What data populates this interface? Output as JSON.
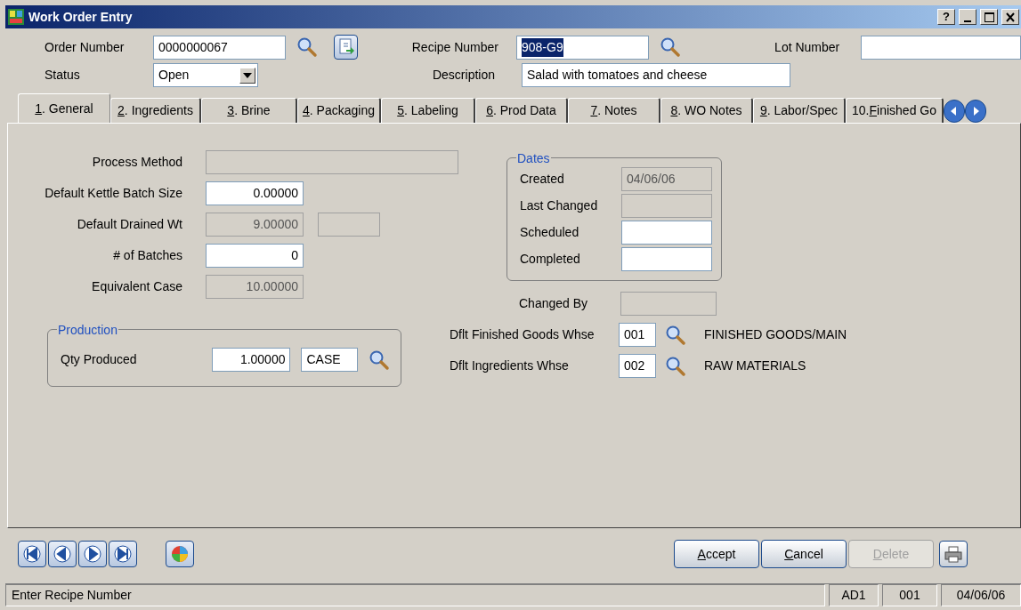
{
  "window": {
    "title": "Work Order Entry",
    "help_button": "?"
  },
  "header": {
    "order_number": {
      "label": "Order Number",
      "value": "0000000067"
    },
    "status": {
      "label": "Status",
      "value": "Open"
    },
    "recipe_number": {
      "label": "Recipe Number",
      "value": "908-G9",
      "highlighted": true
    },
    "description": {
      "label": "Description",
      "value": "Salad with tomatoes and cheese"
    },
    "lot_number": {
      "label": "Lot Number"
    }
  },
  "tabs": [
    {
      "key": "1",
      "after": ". General",
      "selected": true
    },
    {
      "key": "2",
      "after": ". Ingredients",
      "selected": false
    },
    {
      "key": "3",
      "after": ". Brine",
      "selected": false
    },
    {
      "key": "4",
      "after": ". Packaging",
      "selected": false
    },
    {
      "key": "5",
      "after": ". Labeling",
      "selected": false
    },
    {
      "key": "6",
      "after": ". Prod Data",
      "selected": false
    },
    {
      "key": "7",
      "after": ". Notes",
      "selected": false
    },
    {
      "key": "8",
      "after": ". WO Notes",
      "selected": false
    },
    {
      "key": "9",
      "after": ". Labor/Spec",
      "selected": false
    },
    {
      "before": "10. ",
      "key": "F",
      "after": "inished Go",
      "selected": false
    }
  ],
  "general": {
    "fields": [
      {
        "label": "Process Method",
        "kind": "wide",
        "readonly": true
      },
      {
        "label": "Default Kettle Batch Size",
        "kind": "number",
        "readonly": false,
        "value": "0.00000"
      },
      {
        "label": "Default Drained Wt",
        "kind": "number_unit",
        "readonly": true,
        "value": "9.00000"
      },
      {
        "label": "# of Batches",
        "kind": "number",
        "readonly": false,
        "value": "0"
      },
      {
        "label": "Equivalent Case",
        "kind": "number",
        "readonly": true,
        "value": "10.00000"
      }
    ],
    "production": {
      "title": "Production",
      "label": "Qty Produced",
      "value": "1.00000",
      "unit": "CASE"
    },
    "dates": {
      "title": "Dates",
      "fields": [
        {
          "label": "Created",
          "readonly": true,
          "value": "04/06/06"
        },
        {
          "label": "Last Changed",
          "readonly": true
        },
        {
          "label": "Scheduled",
          "readonly": false
        },
        {
          "label": "Completed",
          "readonly": false
        }
      ]
    },
    "changed_by": {
      "label": "Changed By",
      "readonly": true
    },
    "warehouses": [
      {
        "label": "Dflt Finished Goods Whse",
        "value": "001",
        "name": "FINISHED GOODS/MAIN"
      },
      {
        "label": "Dflt Ingredients Whse",
        "value": "002",
        "name": "RAW MATERIALS"
      }
    ]
  },
  "buttons": [
    {
      "key": "A",
      "after": "ccept",
      "disabled": false
    },
    {
      "key": "C",
      "after": "ancel",
      "disabled": false
    },
    {
      "key": "D",
      "after": "elete",
      "disabled": true
    }
  ],
  "status_bar": {
    "message": "Enter Recipe Number",
    "panels": [
      "AD1",
      "001",
      "04/06/06"
    ]
  }
}
